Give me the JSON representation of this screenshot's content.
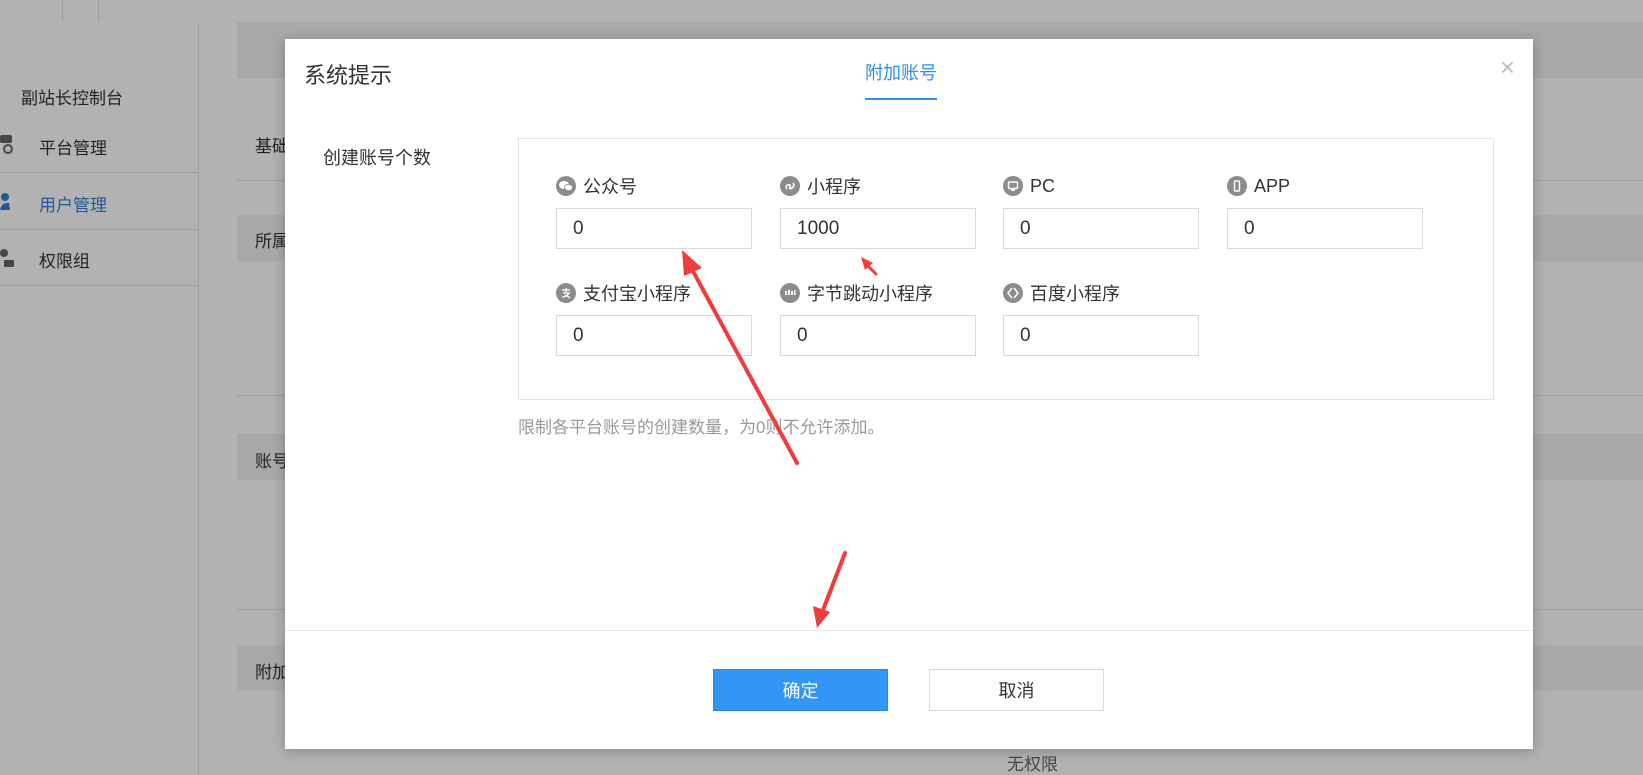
{
  "background": {
    "sidebar": {
      "title": "副站长控制台",
      "items": [
        {
          "label": "平台管理",
          "active": false
        },
        {
          "label": "用户管理",
          "active": true
        },
        {
          "label": "权限组",
          "active": false
        }
      ]
    },
    "content": {
      "labels": [
        "基础",
        "所属",
        "账号",
        "附加"
      ],
      "no_permission": "无权限"
    }
  },
  "modal": {
    "title": "系统提示",
    "tab": "附加账号",
    "close_symbol": "×",
    "field_label": "创建账号个数",
    "accounts": [
      {
        "name": "公众号",
        "icon": "wechat-icon",
        "value": "0"
      },
      {
        "name": "小程序",
        "icon": "mini-program-icon",
        "value": "1000"
      },
      {
        "name": "PC",
        "icon": "pc-icon",
        "value": "0"
      },
      {
        "name": "APP",
        "icon": "app-icon",
        "value": "0"
      },
      {
        "name": "支付宝小程序",
        "icon": "alipay-icon",
        "value": "0"
      },
      {
        "name": "字节跳动小程序",
        "icon": "bytedance-icon",
        "value": "0"
      },
      {
        "name": "百度小程序",
        "icon": "baidu-icon",
        "value": "0"
      }
    ],
    "hint": "限制各平台账号的创建数量，为0则不允许添加。",
    "confirm_label": "确定",
    "cancel_label": "取消"
  },
  "colors": {
    "accent": "#2f8ef0",
    "confirm_button": "#3296f6",
    "annotation_arrow": "#f03c3c"
  }
}
